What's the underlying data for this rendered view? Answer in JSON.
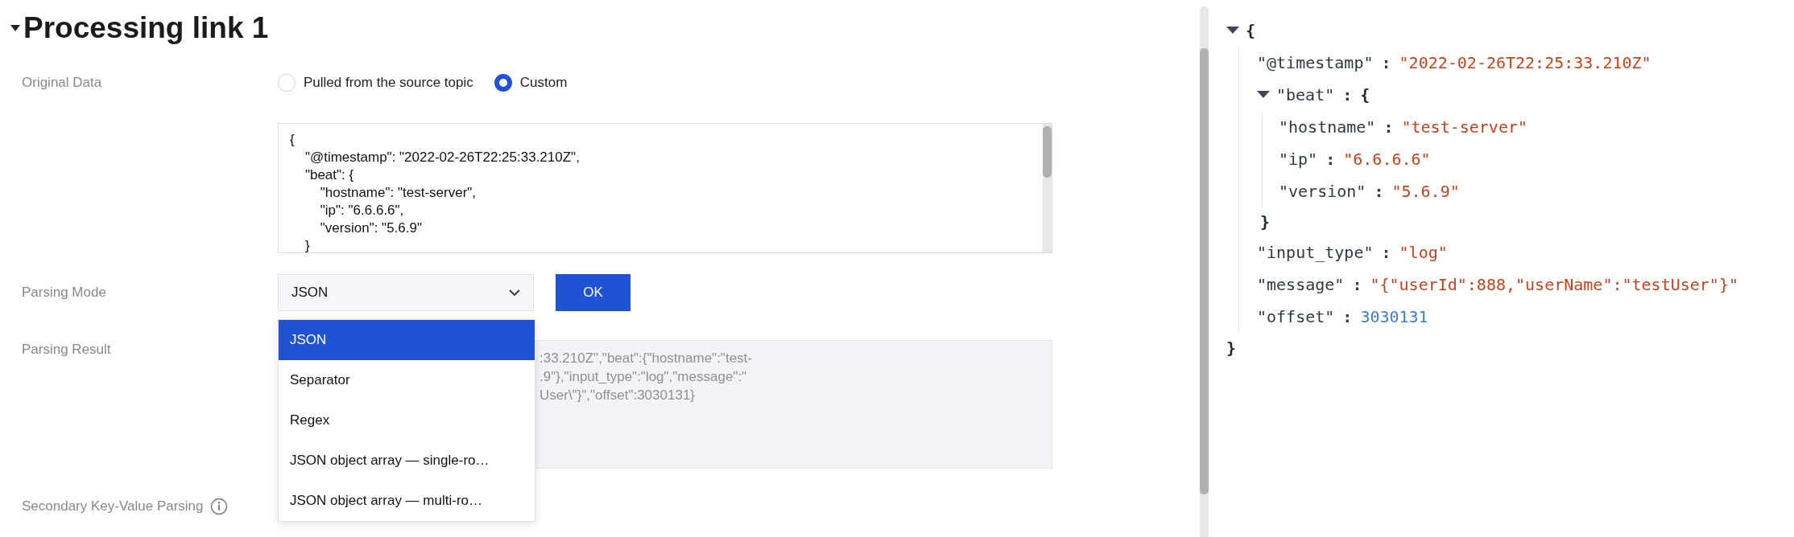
{
  "section": {
    "title": "Processing link 1",
    "expanded": true
  },
  "original_data": {
    "label": "Original Data",
    "options": [
      {
        "label": "Pulled from the source topic",
        "selected": false
      },
      {
        "label": "Custom",
        "selected": true
      }
    ],
    "value": "{\n\t\"@timestamp\": \"2022-02-26T22:25:33.210Z\",\n\t\"beat\": {\n\t\t\"hostname\": \"test-server\",\n\t\t\"ip\": \"6.6.6.6\",\n\t\t\"version\": \"5.6.9\"\n\t}"
  },
  "parsing_mode": {
    "label": "Parsing Mode",
    "value": "JSON",
    "button": "OK",
    "expanded": true,
    "options": [
      {
        "label": "JSON",
        "selected": true
      },
      {
        "label": "Separator",
        "selected": false
      },
      {
        "label": "Regex",
        "selected": false
      },
      {
        "label": "JSON object array — single-ro…",
        "selected": false
      },
      {
        "label": "JSON object array — multi-ro…",
        "selected": false
      }
    ]
  },
  "parsing_result": {
    "label": "Parsing Result",
    "lines": [
      ":33.210Z\",\"beat\":{\"hostname\":\"test-",
      ".9\"},\"input_type\":\"log\",\"message\":\"",
      "User\\\"}\",\"offset\":3030131}"
    ]
  },
  "secondary_parsing": {
    "label": "Secondary Key-Value Parsing"
  },
  "viewer": {
    "open": "{",
    "close": "}",
    "separator": ":",
    "expanded": true,
    "children": [
      {
        "key": "\"@timestamp\"",
        "kind": "string",
        "value": "\"2022-02-26T22:25:33.210Z\""
      },
      {
        "key": "\"beat\"",
        "kind": "object",
        "open": "{",
        "close": "}",
        "expanded": true,
        "children": [
          {
            "key": "\"hostname\"",
            "kind": "string",
            "value": "\"test-server\""
          },
          {
            "key": "\"ip\"",
            "kind": "string",
            "value": "\"6.6.6.6\""
          },
          {
            "key": "\"version\"",
            "kind": "string",
            "value": "\"5.6.9\""
          }
        ]
      },
      {
        "key": "\"input_type\"",
        "kind": "string",
        "value": "\"log\""
      },
      {
        "key": "\"message\"",
        "kind": "string",
        "value": "\"{\"userId\":888,\"userName\":\"testUser\"}\""
      },
      {
        "key": "\"offset\"",
        "kind": "number",
        "value": "3030131"
      }
    ]
  }
}
